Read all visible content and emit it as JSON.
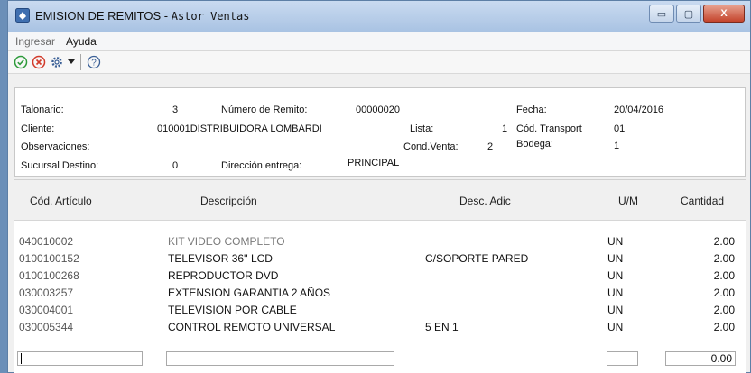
{
  "window": {
    "title": "EMISION DE REMITOS -",
    "title_app": "Astor Ventas",
    "minimize_symbol": "▭",
    "maximize_symbol": "▢",
    "close_symbol": "X"
  },
  "menu": {
    "items": [
      "Ingresar",
      "Ayuda"
    ]
  },
  "toolbar": {
    "accept_icon": "check-circle-icon",
    "cancel_icon": "x-circle-icon",
    "settings_icon": "gear-icon",
    "help_symbol": "?"
  },
  "header": {
    "talonario_label": "Talonario:",
    "talonario_value": "3",
    "numero_label": "Número de Remito:",
    "numero_value": "00000020",
    "fecha_label": "Fecha:",
    "fecha_value": "20/04/2016",
    "cliente_label": "Cliente:",
    "cliente_value": "010001DISTRIBUIDORA LOMBARDI",
    "lista_label": "Lista:",
    "lista_value": "1",
    "transport_label": "Cód. Transport",
    "transport_value": "01",
    "observaciones_label": "Observaciones:",
    "condventa_label": "Cond.Venta:",
    "condventa_value": "2",
    "bodega_label": "Bodega:",
    "bodega_value": "1",
    "sucursal_label": "Sucursal Destino:",
    "sucursal_value": "0",
    "direccion_label": "Dirección entrega:",
    "direccion_value": "PRINCIPAL"
  },
  "grid": {
    "columns": [
      "Cód. Artículo",
      "Descripción",
      "Desc. Adic",
      "U/M",
      "Cantidad"
    ],
    "rows": [
      {
        "code": "040010002",
        "desc": "KIT VIDEO COMPLETO",
        "adic": "",
        "um": "UN",
        "qty": "2.00"
      },
      {
        "code": "0100100152",
        "desc": "TELEVISOR 36'' LCD",
        "adic": "C/SOPORTE PARED",
        "um": "UN",
        "qty": "2.00"
      },
      {
        "code": "0100100268",
        "desc": "REPRODUCTOR DVD",
        "adic": "",
        "um": "UN",
        "qty": "2.00"
      },
      {
        "code": "030003257",
        "desc": "EXTENSION GARANTIA 2 AÑOS",
        "adic": "",
        "um": "UN",
        "qty": "2.00"
      },
      {
        "code": "030004001",
        "desc": "TELEVISION POR CABLE",
        "adic": "",
        "um": "UN",
        "qty": "2.00"
      },
      {
        "code": "030005344",
        "desc": "CONTROL REMOTO UNIVERSAL",
        "adic": "5 EN 1",
        "um": "UN",
        "qty": "2.00"
      }
    ],
    "new_row": {
      "code": "",
      "desc": "",
      "adic": "",
      "um": "",
      "qty": "0.00"
    }
  }
}
